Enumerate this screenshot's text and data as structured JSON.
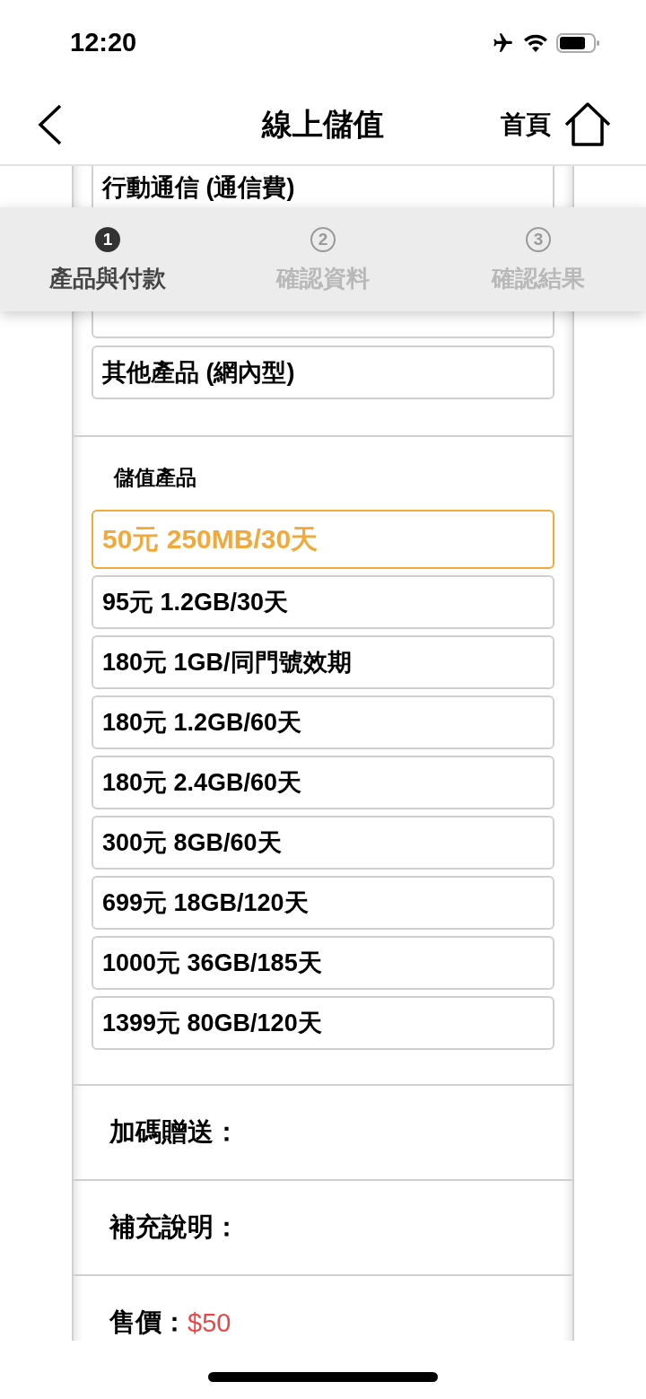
{
  "status_bar": {
    "time": "12:20"
  },
  "nav": {
    "title": "線上儲值",
    "home_label": "首頁"
  },
  "categories": [
    {
      "label": "行動通信 (通信費)",
      "selected": false
    },
    {
      "label": "其他產品 (網內型)",
      "selected": false
    }
  ],
  "steps": [
    {
      "number": "1",
      "label": "產品與付款",
      "active": true
    },
    {
      "number": "2",
      "label": "確認資料",
      "active": false
    },
    {
      "number": "3",
      "label": "確認結果",
      "active": false
    }
  ],
  "products": {
    "heading": "儲值產品",
    "items": [
      {
        "label": "50元 250MB/30天",
        "selected": true
      },
      {
        "label": "95元 1.2GB/30天",
        "selected": false
      },
      {
        "label": "180元 1GB/同門號效期",
        "selected": false
      },
      {
        "label": "180元 1.2GB/60天",
        "selected": false
      },
      {
        "label": "180元 2.4GB/60天",
        "selected": false
      },
      {
        "label": "300元 8GB/60天",
        "selected": false
      },
      {
        "label": "699元 18GB/120天",
        "selected": false
      },
      {
        "label": "1000元 36GB/185天",
        "selected": false
      },
      {
        "label": "1399元 80GB/120天",
        "selected": false
      }
    ]
  },
  "details": [
    {
      "label": "加碼贈送："
    },
    {
      "label": "補充說明："
    }
  ],
  "price": {
    "label": "售價：",
    "value": "$50"
  }
}
